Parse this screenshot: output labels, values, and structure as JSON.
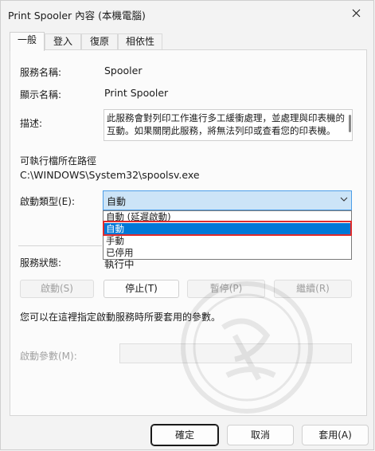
{
  "window": {
    "title": "Print Spooler 內容 (本機電腦)"
  },
  "tabs": [
    {
      "label": "一般",
      "active": true
    },
    {
      "label": "登入",
      "active": false
    },
    {
      "label": "復原",
      "active": false
    },
    {
      "label": "相依性",
      "active": false
    }
  ],
  "general": {
    "service_name_label": "服務名稱:",
    "service_name": "Spooler",
    "display_name_label": "顯示名稱:",
    "display_name": "Print Spooler",
    "description_label": "描述:",
    "description": "此服務會對列印工作進行多工緩衝處理，並處理與印表機的互動。如果關閉此服務，將無法列印或查看您的印表機。",
    "exe_path_label": "可執行檔所在路徑",
    "exe_path": "C:\\WINDOWS\\System32\\spoolsv.exe",
    "startup_type_label": "啟動類型(E):",
    "startup_type_value": "自動",
    "startup_options": [
      "自動 (延遲啟動)",
      "自動",
      "手動",
      "已停用"
    ],
    "startup_selected_index": 1,
    "service_status_label": "服務狀態:",
    "service_status": "執行中",
    "buttons": {
      "start": "啟動(S)",
      "stop": "停止(T)",
      "pause": "暫停(P)",
      "resume": "繼續(R)"
    },
    "hint_text": "您可以在這裡指定啟動服務時所要套用的參數。",
    "start_params_label": "啟動參數(M):",
    "start_params_value": ""
  },
  "footer": {
    "ok": "確定",
    "cancel": "取消",
    "apply": "套用(A)"
  },
  "colors": {
    "selection": "#0078d7",
    "combo_highlight": "#cce4f7",
    "annotation_outline": "#e02b2b"
  }
}
